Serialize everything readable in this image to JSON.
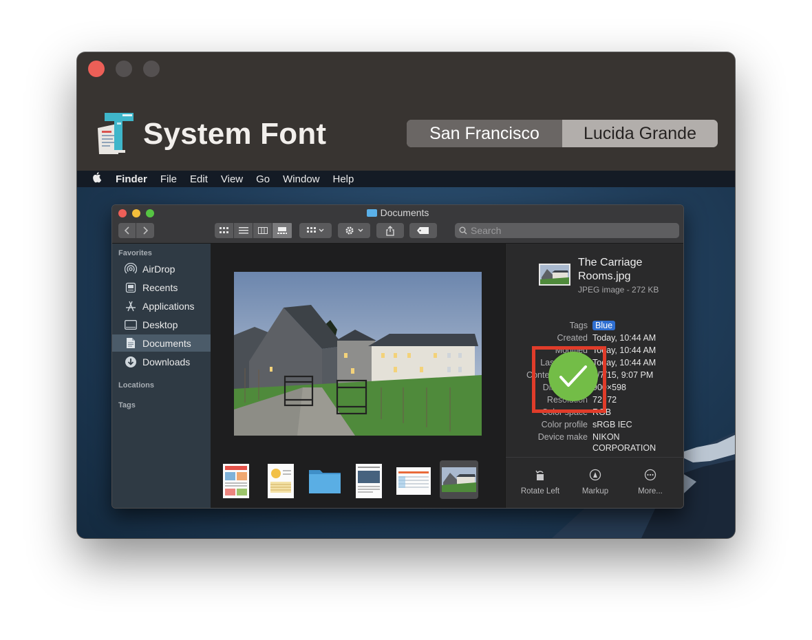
{
  "app": {
    "title": "System Font",
    "segments": [
      "San Francisco",
      "Lucida Grande"
    ],
    "selected_segment": "Lucida Grande"
  },
  "menubar": {
    "apple": "",
    "items": [
      "Finder",
      "File",
      "Edit",
      "View",
      "Go",
      "Window",
      "Help"
    ]
  },
  "finder": {
    "window_title": "Documents",
    "search_placeholder": "Search",
    "sidebar": {
      "favorites_header": "Favorites",
      "items": [
        {
          "label": "AirDrop",
          "icon": "airdrop-icon"
        },
        {
          "label": "Recents",
          "icon": "recents-icon"
        },
        {
          "label": "Applications",
          "icon": "applications-icon"
        },
        {
          "label": "Desktop",
          "icon": "desktop-icon"
        },
        {
          "label": "Documents",
          "icon": "documents-icon",
          "selected": true
        },
        {
          "label": "Downloads",
          "icon": "downloads-icon"
        }
      ],
      "locations_header": "Locations",
      "tags_header": "Tags"
    },
    "inspector": {
      "file_name": "The Carriage Rooms.jpg",
      "file_kind": "JPEG image - 272 KB",
      "metadata": [
        {
          "key": "Tags",
          "value": "Blue"
        },
        {
          "key": "Created",
          "value": "Today, 10:44 AM"
        },
        {
          "key": "Modified",
          "value": "Today, 10:44 AM"
        },
        {
          "key": "Last opened",
          "value": "Today, 10:44 AM"
        },
        {
          "key": "Content created",
          "value": "1/7/15, 9:07 PM"
        },
        {
          "key": "Dimensions",
          "value": "900×598"
        },
        {
          "key": "Resolution",
          "value": "72×72"
        },
        {
          "key": "Color space",
          "value": "RGB"
        },
        {
          "key": "Color profile",
          "value": "sRGB IEC"
        },
        {
          "key": "Device make",
          "value": "NIKON"
        },
        {
          "key": "",
          "value": "CORPORATION"
        }
      ],
      "actions": [
        {
          "label": "Rotate Left",
          "icon": "rotate-left-icon"
        },
        {
          "label": "Markup",
          "icon": "markup-icon"
        },
        {
          "label": "More...",
          "icon": "more-icon"
        }
      ]
    }
  },
  "colors": {
    "close_red": "#ec5f57",
    "selection_blue": "#2f6fd1",
    "highlight_red": "#e03c2a",
    "check_green": "#73bd47"
  }
}
